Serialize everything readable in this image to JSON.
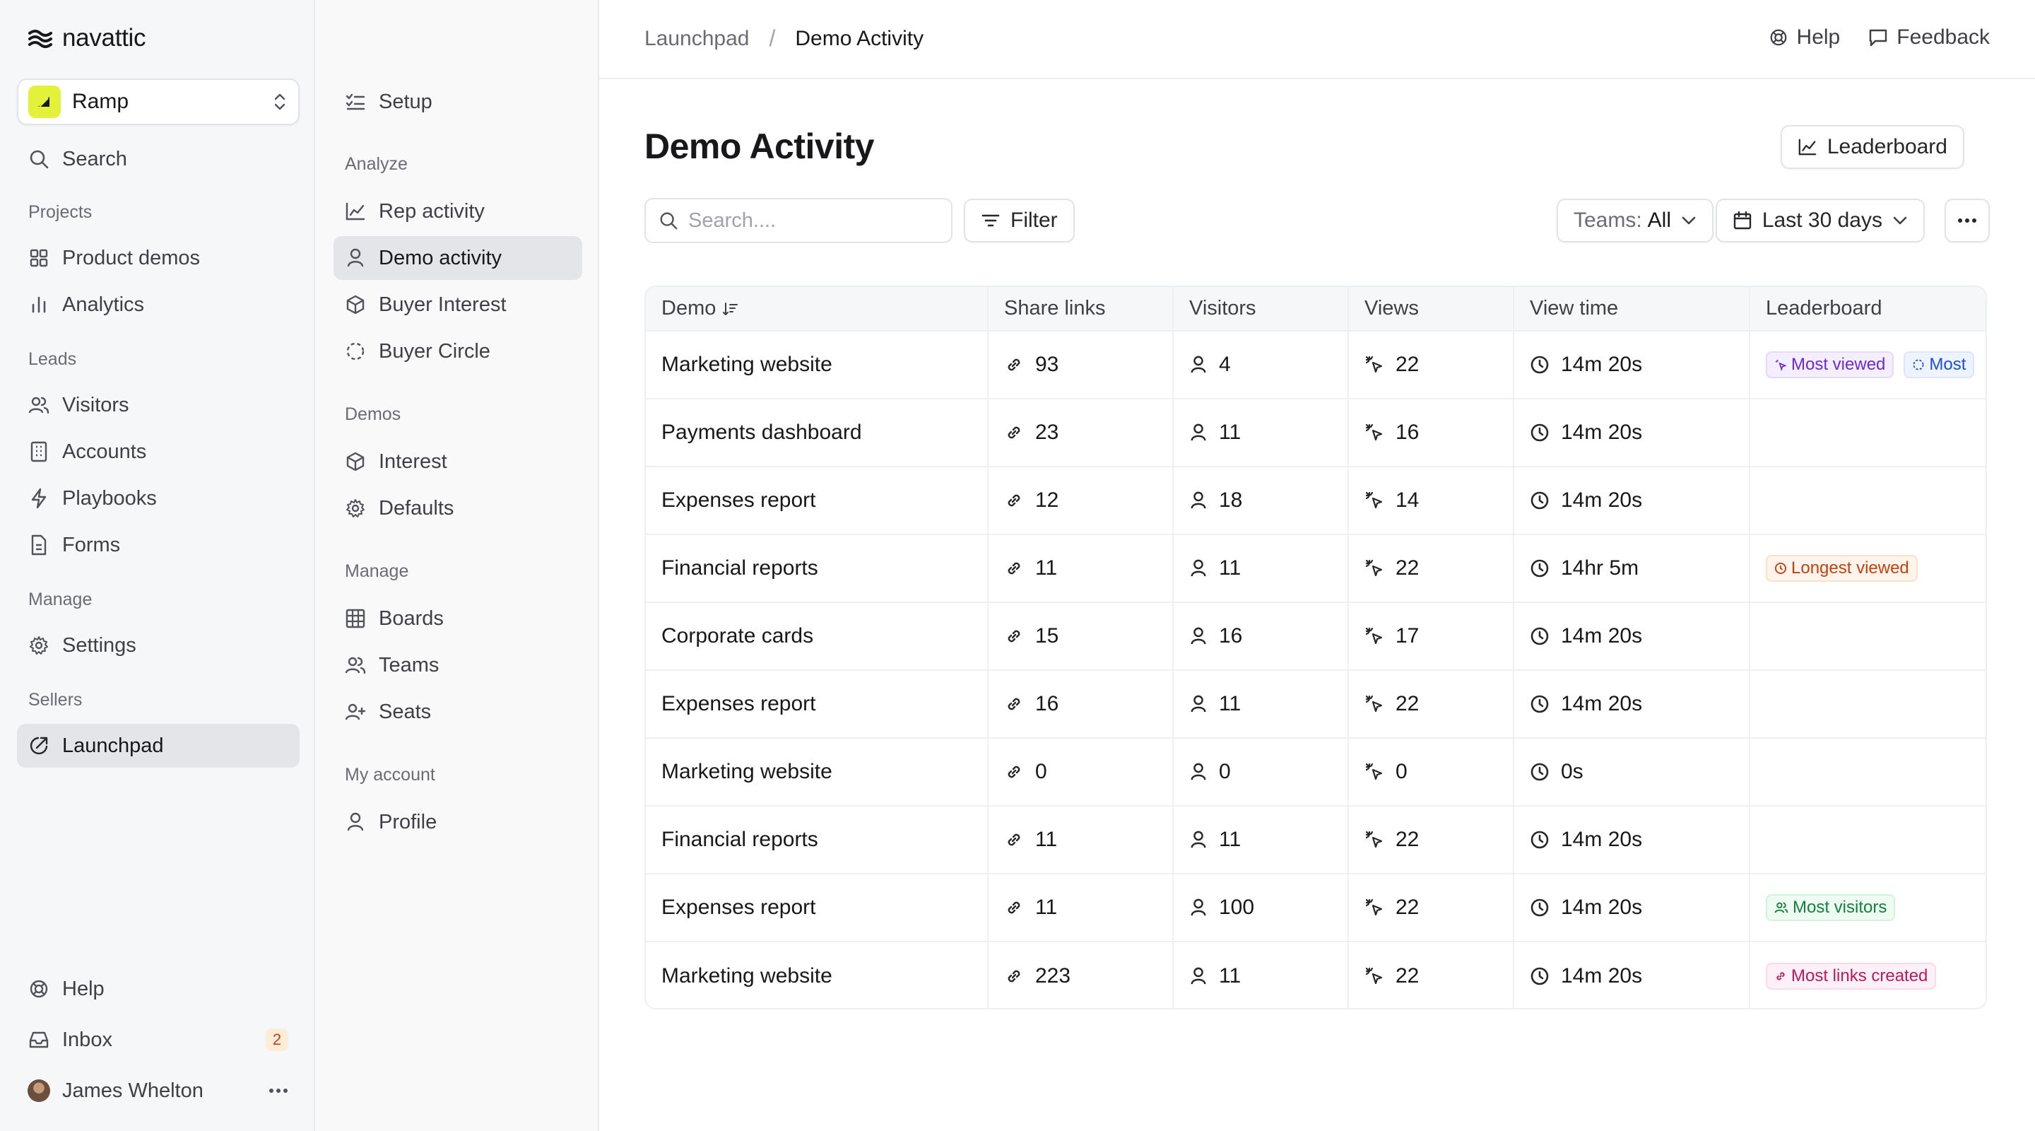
{
  "brand": {
    "name": "navattic"
  },
  "workspace": {
    "name": "Ramp"
  },
  "sidebar": {
    "search_label": "Search",
    "sections": {
      "projects": "Projects",
      "leads": "Leads",
      "manage": "Manage",
      "sellers": "Sellers"
    },
    "items": {
      "product_demos": "Product demos",
      "analytics": "Analytics",
      "visitors": "Visitors",
      "accounts": "Accounts",
      "playbooks": "Playbooks",
      "forms": "Forms",
      "settings": "Settings",
      "launchpad": "Launchpad"
    },
    "footer": {
      "help": "Help",
      "inbox": "Inbox",
      "inbox_count": "2",
      "user_name": "James Whelton"
    }
  },
  "subnav": {
    "setup": "Setup",
    "sections": {
      "analyze": "Analyze",
      "demos": "Demos",
      "manage": "Manage",
      "my_account": "My account"
    },
    "items": {
      "rep_activity": "Rep activity",
      "demo_activity": "Demo activity",
      "buyer_interest": "Buyer Interest",
      "buyer_circle": "Buyer Circle",
      "interest": "Interest",
      "defaults": "Defaults",
      "boards": "Boards",
      "teams": "Teams",
      "seats": "Seats",
      "profile": "Profile"
    }
  },
  "header": {
    "breadcrumb_parent": "Launchpad",
    "breadcrumb_sep": "/",
    "breadcrumb_current": "Demo Activity",
    "help": "Help",
    "feedback": "Feedback"
  },
  "page": {
    "title": "Demo Activity",
    "leaderboard_button": "Leaderboard",
    "search_placeholder": "Search....",
    "filter_button": "Filter",
    "teams_label": "Teams:",
    "teams_value": "All",
    "date_range": "Last 30 days"
  },
  "table": {
    "columns": {
      "demo": "Demo",
      "share_links": "Share links",
      "visitors": "Visitors",
      "views": "Views",
      "view_time": "View time",
      "leaderboard": "Leaderboard"
    },
    "rows": [
      {
        "demo": "Marketing website",
        "share_links": "93",
        "visitors": "4",
        "views": "22",
        "view_time": "14m 20s",
        "tags": [
          {
            "label": "Most viewed",
            "color": "purple",
            "icon": "sparkle-icon"
          },
          {
            "label": "Most",
            "color": "blue",
            "icon": "dashed-circle-icon"
          }
        ]
      },
      {
        "demo": "Payments dashboard",
        "share_links": "23",
        "visitors": "11",
        "views": "16",
        "view_time": "14m 20s",
        "tags": []
      },
      {
        "demo": "Expenses report",
        "share_links": "12",
        "visitors": "18",
        "views": "14",
        "view_time": "14m 20s",
        "tags": []
      },
      {
        "demo": "Financial reports",
        "share_links": "11",
        "visitors": "11",
        "views": "22",
        "view_time": "14hr 5m",
        "tags": [
          {
            "label": "Longest viewed",
            "color": "orange",
            "icon": "clock-icon"
          }
        ]
      },
      {
        "demo": "Corporate cards",
        "share_links": "15",
        "visitors": "16",
        "views": "17",
        "view_time": "14m 20s",
        "tags": []
      },
      {
        "demo": "Expenses report",
        "share_links": "16",
        "visitors": "11",
        "views": "22",
        "view_time": "14m 20s",
        "tags": []
      },
      {
        "demo": "Marketing website",
        "share_links": "0",
        "visitors": "0",
        "views": "0",
        "view_time": "0s",
        "tags": []
      },
      {
        "demo": "Financial reports",
        "share_links": "11",
        "visitors": "11",
        "views": "22",
        "view_time": "14m 20s",
        "tags": []
      },
      {
        "demo": "Expenses report",
        "share_links": "11",
        "visitors": "100",
        "views": "22",
        "view_time": "14m 20s",
        "tags": [
          {
            "label": "Most visitors",
            "color": "green",
            "icon": "users-icon"
          }
        ]
      },
      {
        "demo": "Marketing website",
        "share_links": "223",
        "visitors": "11",
        "views": "22",
        "view_time": "14m 20s",
        "tags": [
          {
            "label": "Most links created",
            "color": "pink",
            "icon": "link-icon"
          }
        ]
      }
    ]
  },
  "colors": {
    "accent_brand": "#e4f13a",
    "active_bg": "#e4e5e8",
    "badge_orange": "#c2410c"
  }
}
